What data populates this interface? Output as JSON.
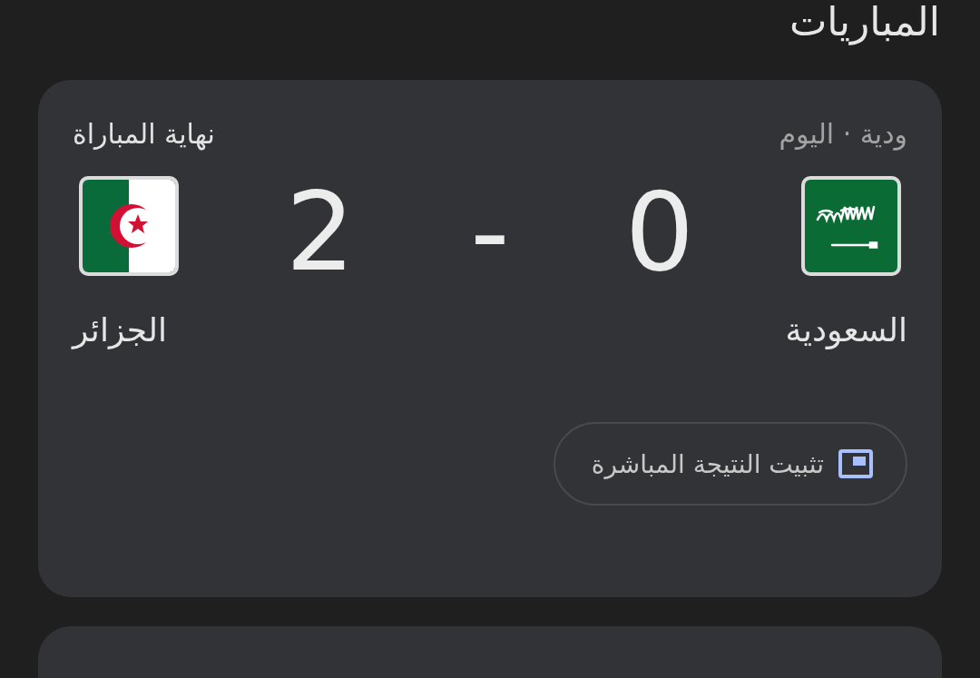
{
  "section_title": "المباريات",
  "match": {
    "info": "ودية · اليوم",
    "status": "نهاية المباراة",
    "separator": "-",
    "teams": [
      {
        "name": "السعودية",
        "score": "0",
        "kind": "saudi"
      },
      {
        "name": "الجزائر",
        "score": "2",
        "kind": "algeria"
      }
    ],
    "pin_button": "تثبيت النتيجة المباشرة"
  }
}
